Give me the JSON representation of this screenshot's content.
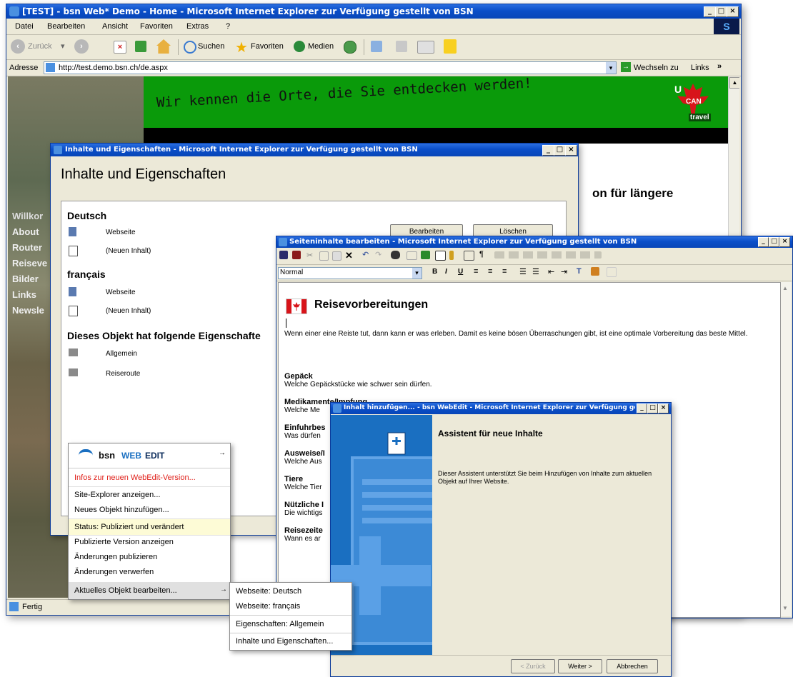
{
  "main_window": {
    "title": "[TEST] - bsn Web* Demo - Home - Microsoft Internet Explorer  zur Verfügung gestellt von BSN",
    "menu": [
      "Datei",
      "Bearbeiten",
      "Ansicht",
      "Favoriten",
      "Extras",
      "?"
    ],
    "toolbar": {
      "back": "Zurück",
      "search": "Suchen",
      "favorites": "Favoriten",
      "media": "Medien"
    },
    "address_label": "Adresse",
    "address_value": "http://test.demo.bsn.ch/de.aspx",
    "go_label": "Wechseln zu",
    "links_label": "Links",
    "status": "Fertig",
    "banner_text": "Wir kennen die Orte, die Sie entdecken werden!",
    "logo": {
      "u": "U",
      "can": "CAN",
      "travel": "travel"
    },
    "headline_fragment": "on für längere",
    "sidebar_links": [
      "Willkor",
      "About",
      "Router",
      "Reiseve",
      "Bilder",
      "Links",
      "Newsle"
    ]
  },
  "props_window": {
    "title": "Inhalte und Eigenschaften - Microsoft Internet Explorer  zur Verfügung gestellt von BSN",
    "heading": "Inhalte und Eigenschaften",
    "sec_de": "Deutsch",
    "de_items": [
      "Webseite",
      "(Neuen Inhalt)"
    ],
    "btn_edit": "Bearbeiten",
    "btn_delete": "Löschen",
    "sec_fr": "français",
    "fr_items": [
      "Webseite",
      "(Neuen Inhalt)"
    ],
    "sec_props": "Dieses Objekt hat folgende Eigenschafte",
    "prop_items": [
      "Allgemein",
      "Reiseroute"
    ]
  },
  "editor_window": {
    "title": "Seiteninhalte bearbeiten - Microsoft Internet Explorer  zur Verfügung gestellt von BSN",
    "style_value": "Normal",
    "heading": "Reisevorbereitungen",
    "intro": "Wenn einer eine Reiste tut, dann kann er was erleben. Damit es keine bösen Überraschungen gibt, ist eine optimale Vorbereitung das beste Mittel.",
    "sections": [
      {
        "h": "Gepäck",
        "t": "Welche Gepäckstücke wie schwer sein dürfen."
      },
      {
        "h": "Medikamente/Impfung",
        "t": "Welche Me"
      },
      {
        "h": "Einfuhrbes",
        "t": "Was dürfen"
      },
      {
        "h": "Ausweise/I",
        "t": "Welche Aus"
      },
      {
        "h": "Tiere",
        "t": "Welche Tier"
      },
      {
        "h": "Nützliche I",
        "t": "Die wichtigs"
      },
      {
        "h": "Reisezeite",
        "t": "Wann es ar"
      }
    ]
  },
  "wizard": {
    "title": "Inhalt hinzufügen... - bsn WebEdit - Microsoft Internet Explorer  zur Verfügung gestellt...",
    "heading": "Assistent für neue Inhalte",
    "text": "Dieser Assistent unterstützt Sie beim Hinzufügen von Inhalte zum aktuellen Objekt auf Ihrer Website.",
    "btn_back": "< Zurück",
    "btn_next": "Weiter >",
    "btn_cancel": "Abbrechen"
  },
  "webedit_menu": {
    "brand_bsn": "bsn",
    "brand_web": "WEB",
    "brand_edit": "EDIT",
    "info": "Infos zur neuen WebEdit-Version...",
    "items1": [
      "Site-Explorer anzeigen...",
      "Neues Objekt hinzufügen..."
    ],
    "status": "Status: Publiziert und verändert",
    "items2": [
      "Publizierte Version anzeigen",
      "Änderungen publizieren",
      "Änderungen verwerfen"
    ],
    "current": "Aktuelles Objekt bearbeiten..."
  },
  "submenu": {
    "items1": [
      "Webseite: Deutsch",
      "Webseite: français"
    ],
    "items2": [
      "Eigenschaften: Allgemein"
    ],
    "items3": [
      "Inhalte und Eigenschaften..."
    ]
  },
  "colors": {
    "xp_blue": "#0a4ec8",
    "banner_green": "#0a9a0a",
    "maple_red": "#d8141a",
    "wizard_blue": "#1a6fc1",
    "menu_red": "#e0201a",
    "highlight": "#fdfbd6"
  }
}
